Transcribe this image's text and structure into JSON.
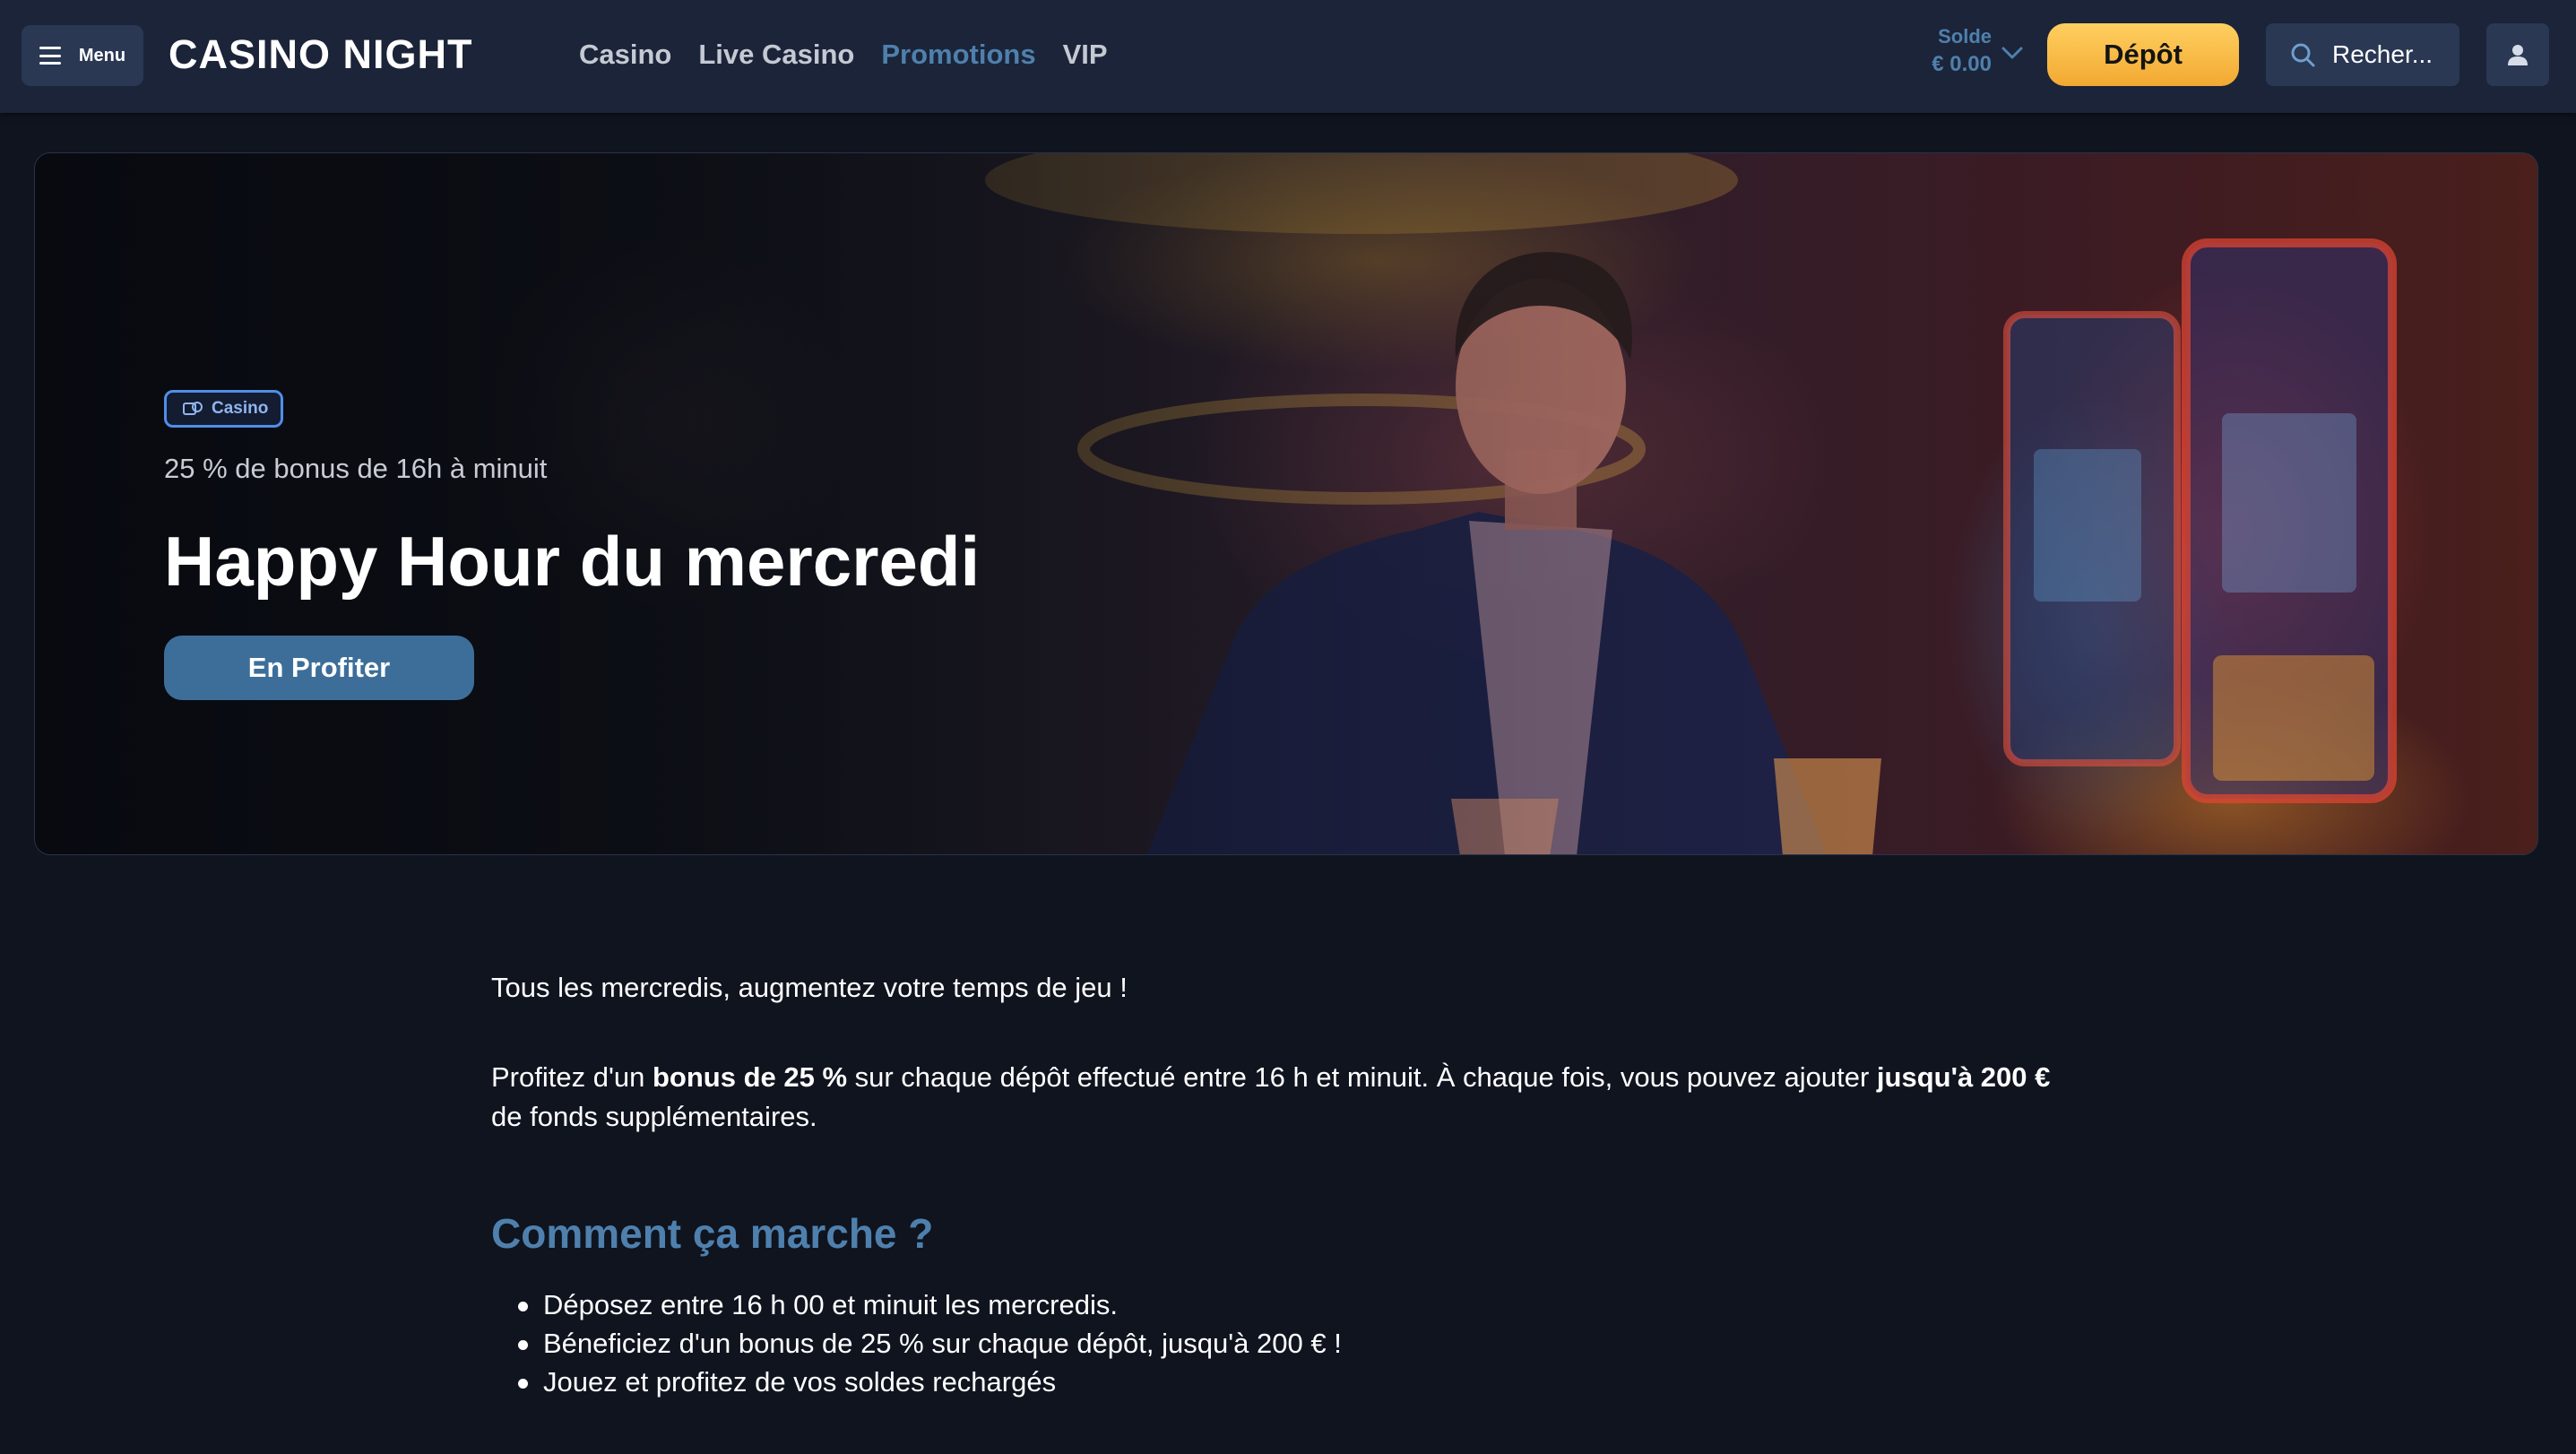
{
  "header": {
    "menu_label": "Menu",
    "logo_text": "CASINO NIGHT",
    "nav": [
      {
        "label": "Casino",
        "active": false
      },
      {
        "label": "Live Casino",
        "active": false
      },
      {
        "label": "Promotions",
        "active": true
      },
      {
        "label": "VIP",
        "active": false
      }
    ],
    "balance_label": "Solde",
    "balance_value": "€ 0.00",
    "deposit_label": "Dépôt",
    "search_placeholder": "Recher..."
  },
  "hero": {
    "badge": "Casino",
    "subtitle": "25 % de bonus de 16h à minuit",
    "title": "Happy Hour du mercredi",
    "cta": "En Profiter"
  },
  "article": {
    "p1": "Tous les mercredis, augmentez votre temps de jeu !",
    "p2_part1": "Profitez d'un ",
    "p2_bold1": "bonus de 25 %",
    "p2_part2": " sur chaque dépôt effectué entre 16 h et minuit. À chaque fois, vous pouvez ajouter ",
    "p2_bold2": "jusqu'à 200 €",
    "p2_part3": " de fonds supplémentaires.",
    "heading": "Comment ça marche ?",
    "steps": [
      "Déposez entre 16 h 00 et minuit les mercredis.",
      "Béneficiez d'un bonus de 25 % sur chaque dépôt, jusqu'à 200 € !",
      "Jouez et profitez de vos soldes rechargés"
    ]
  },
  "colors": {
    "accent": "#4f80ad",
    "deposit": "#f2a932",
    "header_bg": "#1b2438",
    "page_bg": "#0f141f"
  }
}
